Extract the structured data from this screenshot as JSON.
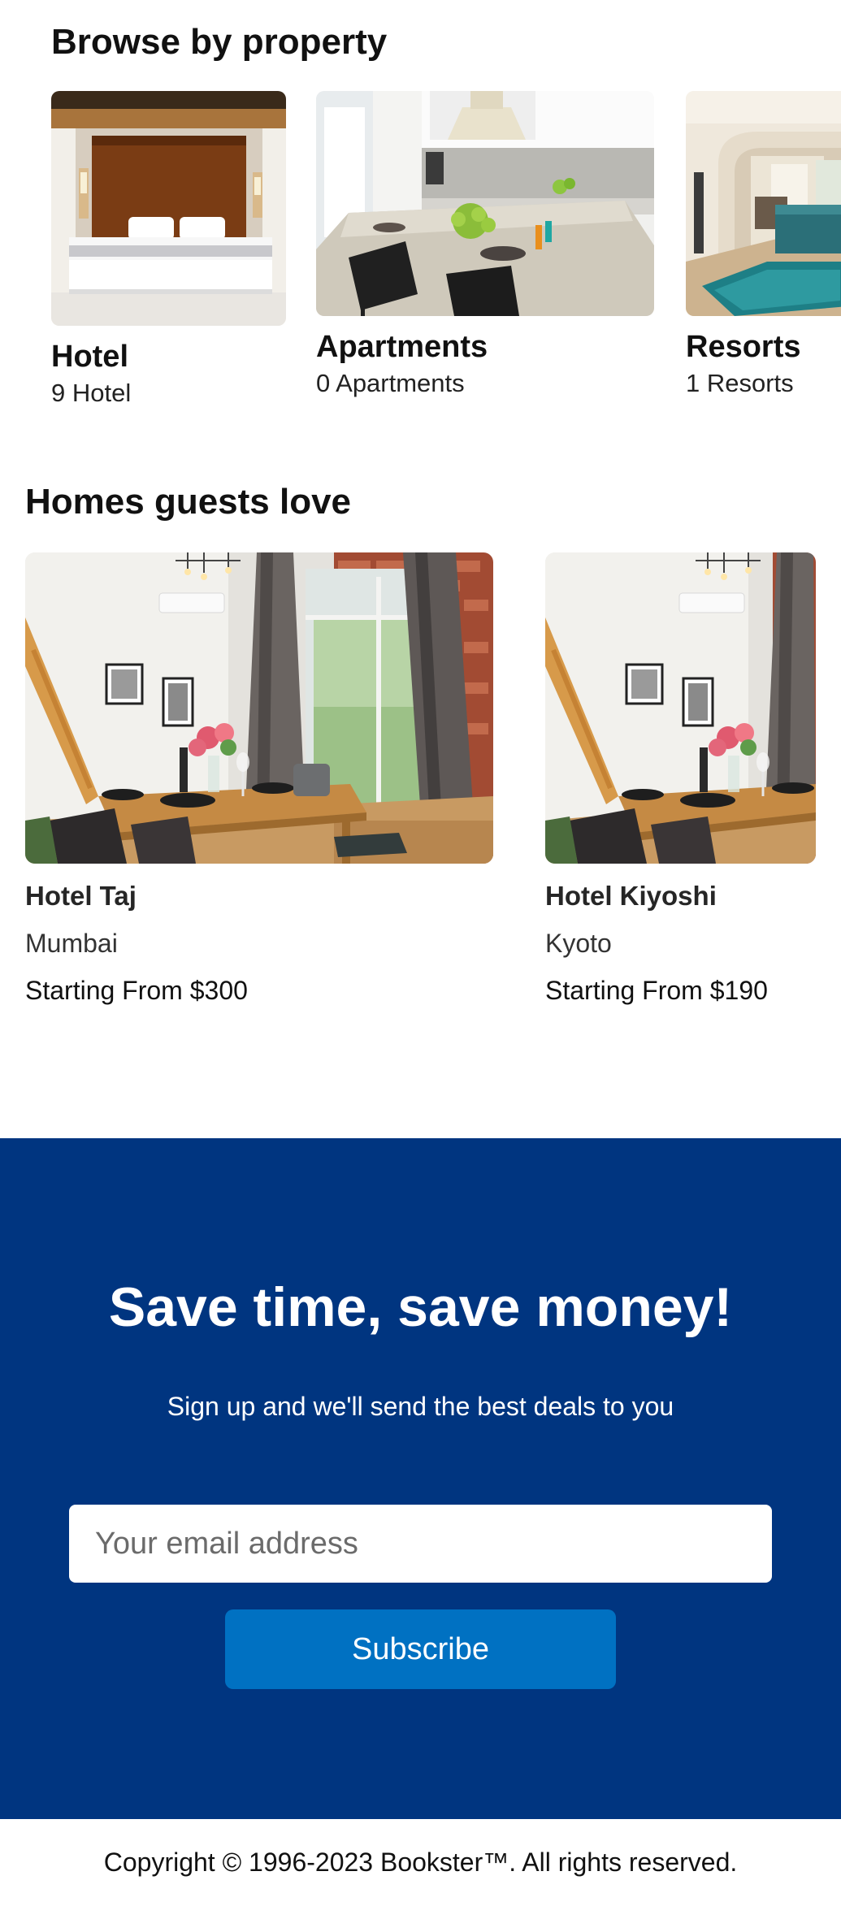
{
  "browse": {
    "heading": "Browse by property",
    "items": [
      {
        "title": "Hotel",
        "count": "9 Hotel",
        "image": "hotel-bedroom-photo"
      },
      {
        "title": "Apartments",
        "count": "0 Apartments",
        "image": "apartment-kitchen-photo"
      },
      {
        "title": "Resorts",
        "count": "1 Resorts",
        "image": "resort-lobby-photo"
      }
    ]
  },
  "homes": {
    "heading": "Homes guests love",
    "items": [
      {
        "name": "Hotel Taj",
        "city": "Mumbai",
        "price": "Starting From $300",
        "image": "loft-dining-room-photo"
      },
      {
        "name": "Hotel Kiyoshi",
        "city": "Kyoto",
        "price": "Starting From $190",
        "image": "loft-dining-room-photo"
      }
    ]
  },
  "newsletter": {
    "title": "Save time, save money!",
    "subtitle": "Sign up and we'll send the best deals to you",
    "email_placeholder": "Your email address",
    "button_label": "Subscribe"
  },
  "footer": {
    "copyright": "Copyright © 1996-2023 Bookster™. All rights reserved."
  },
  "colors": {
    "newsletter_bg": "#003580",
    "button_bg": "#0071c2",
    "text": "#111111"
  }
}
